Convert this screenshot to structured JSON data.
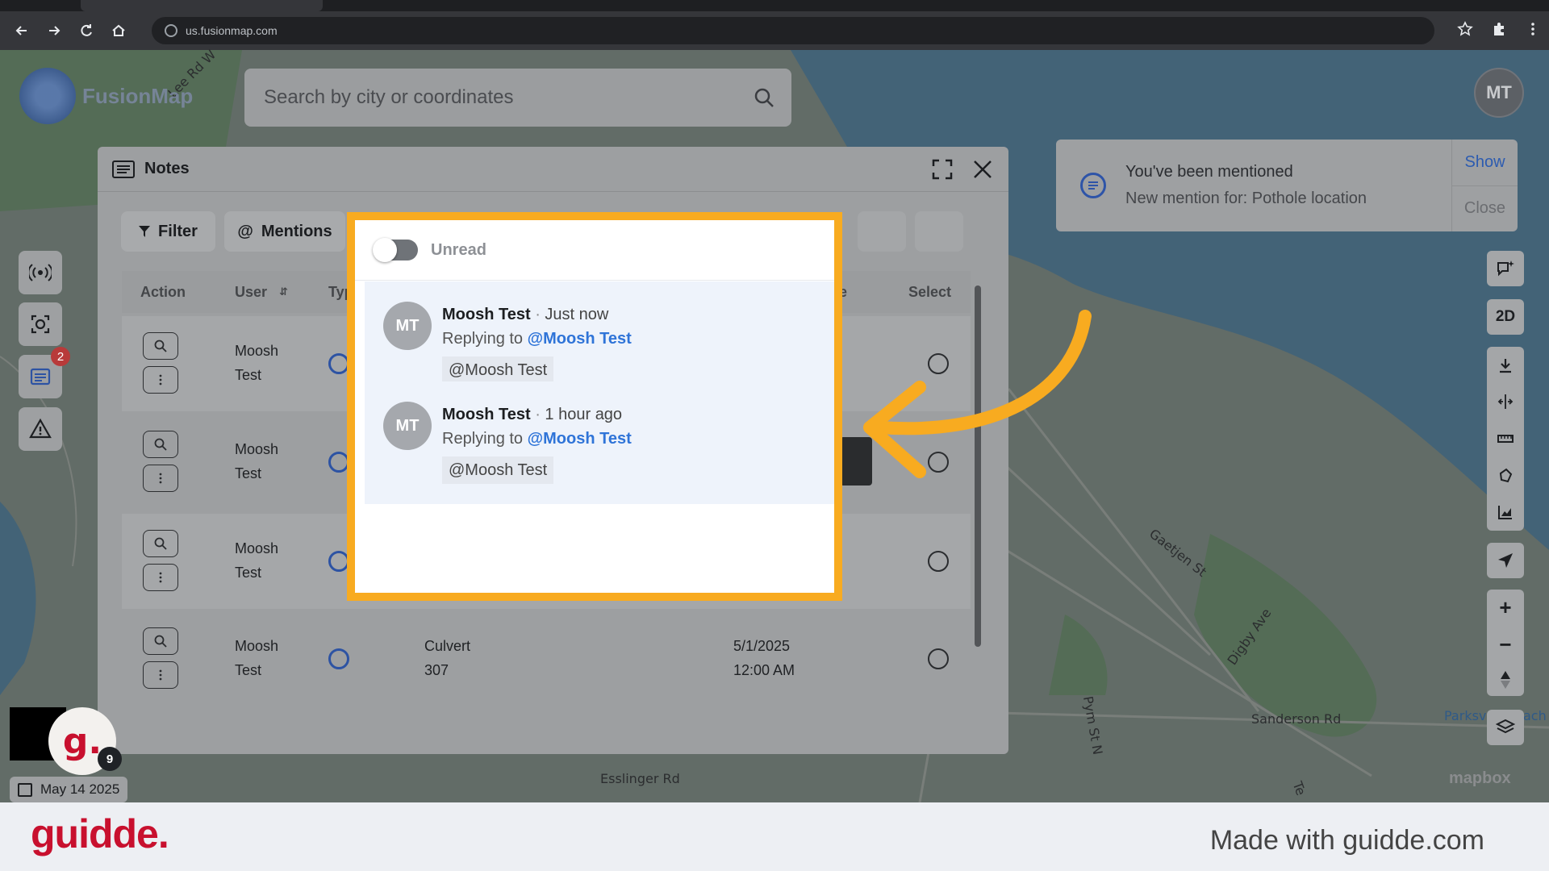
{
  "browser": {
    "url": "us.fusionmap.com"
  },
  "app": {
    "logo_text": "FusionMap",
    "search_placeholder": "Search by city or coordinates",
    "user_initials": "MT"
  },
  "toast": {
    "title": "You've been mentioned",
    "message": "New mention for: Pothole location",
    "show_label": "Show",
    "close_label": "Close"
  },
  "left_toolbar": {
    "notes_badge": "2"
  },
  "right_toolbar": {
    "view_mode_label": "2D",
    "zoom_in": "+",
    "zoom_out": "−"
  },
  "map_labels": {
    "road1": "Lee Rd W",
    "road2": "Gaetjen St",
    "road3": "Digby Ave",
    "road4": "Pym St N",
    "road5": "Sanderson Rd",
    "road6": "Esslinger Rd",
    "road7": "Parksv",
    "road8": "ach",
    "road9": "Te"
  },
  "notes": {
    "title": "Notes",
    "filter_label": "Filter",
    "mentions_label": "Mentions",
    "columns": {
      "action": "Action",
      "user": "User",
      "type": "Typ",
      "title": "le",
      "select": "Select"
    },
    "rows": [
      {
        "user": "Moosh Test",
        "name": "",
        "date": ""
      },
      {
        "user": "Moosh Test",
        "name": "",
        "date": ""
      },
      {
        "user": "Moosh Test",
        "name": "",
        "date": ""
      },
      {
        "user": "Moosh Test",
        "name": "Culvert 307",
        "date": "5/1/2025 12:00 AM"
      }
    ]
  },
  "mentions_popup": {
    "toggle_label": "Unread",
    "items": [
      {
        "initials": "MT",
        "author": "Moosh Test",
        "time": "Just now",
        "replying_prefix": "Replying to",
        "replying_to": "@Moosh Test",
        "body": "@Moosh Test"
      },
      {
        "initials": "MT",
        "author": "Moosh Test",
        "time": "1 hour ago",
        "replying_prefix": "Replying to",
        "replying_to": "@Moosh Test",
        "body": "@Moosh Test"
      }
    ]
  },
  "footer": {
    "date": "May 14 2025",
    "guidde_initial": "g.",
    "guidde_count": "9",
    "mapbox": "mapbox",
    "brand": "guidde.",
    "made_with": "Made with guidde.com"
  },
  "colors": {
    "highlight_border": "#f8ab20",
    "arrow": "#f8ab20",
    "brand_red": "#c8102e",
    "link_blue": "#2f74d8"
  }
}
